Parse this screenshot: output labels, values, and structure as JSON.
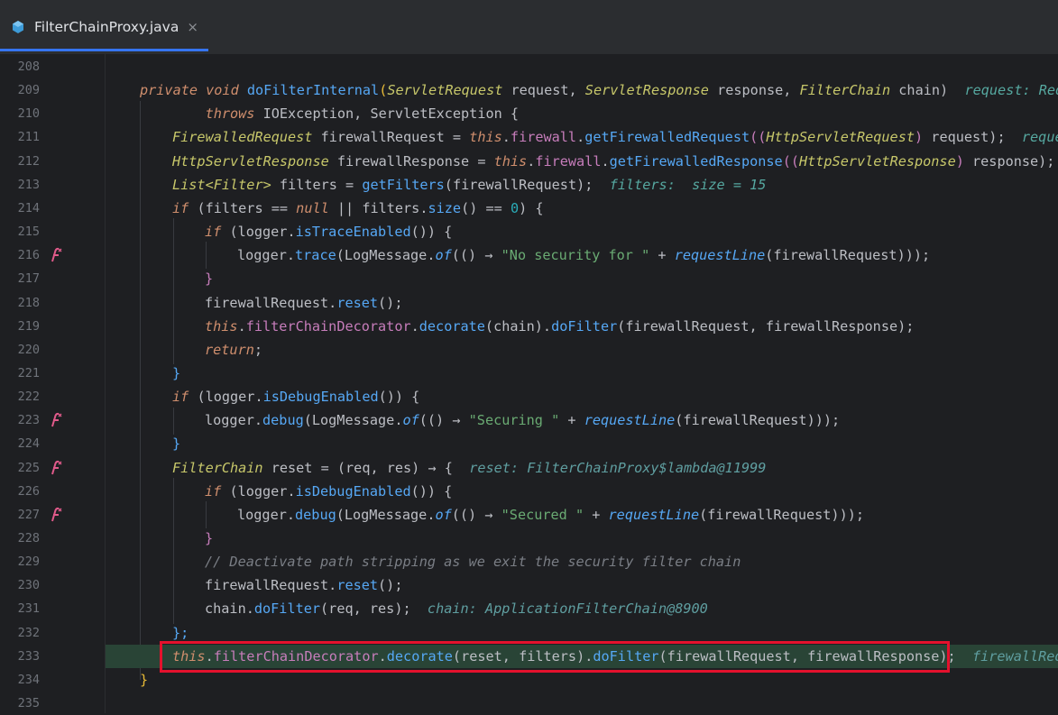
{
  "tabs": [
    {
      "label": "FilterChainProxy.java",
      "active": true,
      "icon": "java-class-icon",
      "close": "×"
    }
  ],
  "editor": {
    "lines": [
      {
        "n": "208"
      },
      {
        "n": "209"
      },
      {
        "n": "210"
      },
      {
        "n": "211"
      },
      {
        "n": "212"
      },
      {
        "n": "213"
      },
      {
        "n": "214"
      },
      {
        "n": "215"
      },
      {
        "n": "216",
        "lambda_icon": true
      },
      {
        "n": "217"
      },
      {
        "n": "218"
      },
      {
        "n": "219"
      },
      {
        "n": "220"
      },
      {
        "n": "221"
      },
      {
        "n": "222"
      },
      {
        "n": "223",
        "lambda_icon": true
      },
      {
        "n": "224"
      },
      {
        "n": "225",
        "lambda_icon": true
      },
      {
        "n": "226"
      },
      {
        "n": "227",
        "lambda_icon": true
      },
      {
        "n": "228"
      },
      {
        "n": "229"
      },
      {
        "n": "230"
      },
      {
        "n": "231"
      },
      {
        "n": "232"
      },
      {
        "n": "233",
        "execution_point": true
      },
      {
        "n": "234"
      },
      {
        "n": "235"
      }
    ],
    "code": {
      "l209": {
        "mods": "private void ",
        "name": "doFilterInternal",
        "p1t": "ServletRequest",
        "p1": " request, ",
        "p2t": "ServletResponse",
        "p2": " response, ",
        "p3t": "FilterChain",
        "p3": " chain)",
        "hint": "request: Requ"
      },
      "l210": {
        "throws": "throws ",
        "rest": "IOException, ServletException {"
      },
      "l211": {
        "t": "FirewalledRequest",
        "v": " firewallRequest = ",
        "this": "this",
        "f": "firewall",
        "m": "getFirewalledRequest",
        "cast": "HttpServletRequest",
        "arg": " request);",
        "hint": "reques"
      },
      "l212": {
        "t": "HttpServletResponse",
        "v": " firewallResponse = ",
        "this": "this",
        "f": "firewall",
        "m": "getFirewalledResponse",
        "cast": "HttpServletResponse",
        "arg": " response);"
      },
      "l213": {
        "t": "List",
        "g": "Filter",
        "v": " filters = ",
        "m": "getFilters",
        "arg": "(firewallRequest);",
        "hint": "filters:  size = 15"
      },
      "l214": {
        "a": "if",
        "b": " (filters ",
        "c": "==",
        "d": " null",
        "e": " || filters.",
        "m": "size",
        "f": "() ",
        "g": "==",
        "h": " 0",
        "i": ") {"
      },
      "l215": {
        "a": "if",
        "b": " (logger.",
        "m": "isTraceEnabled",
        "c": "()) {"
      },
      "l216": {
        "a": "logger.",
        "m": "trace",
        "b": "(LogMessage.",
        "of": "of",
        "c": "(() ",
        "arrow": "→",
        "s": "\"No security for \"",
        "d": " + ",
        "rl": "requestLine",
        "e": "(firewallRequest)));"
      },
      "l217": {
        "a": "}"
      },
      "l218": {
        "a": "firewallRequest.",
        "m": "reset",
        "b": "();"
      },
      "l219": {
        "this": "this",
        "f": "filterChainDecorator",
        "m": "decorate",
        "b": "(chain).",
        "m2": "doFilter",
        "c": "(firewallRequest, firewallResponse);"
      },
      "l220": {
        "a": "return",
        "b": ";"
      },
      "l221": {
        "a": "}"
      },
      "l222": {
        "a": "if",
        "b": " (logger.",
        "m": "isDebugEnabled",
        "c": "()) {"
      },
      "l223": {
        "a": "logger.",
        "m": "debug",
        "b": "(LogMessage.",
        "of": "of",
        "c": "(() ",
        "arrow": "→",
        "s": "\"Securing \"",
        "d": " + ",
        "rl": "requestLine",
        "e": "(firewallRequest)));"
      },
      "l224": {
        "a": "}"
      },
      "l225": {
        "t": "FilterChain",
        "v": " reset = (req, res) ",
        "arrow": "→",
        "b": " {",
        "hint": "reset: FilterChainProxy$lambda@11999"
      },
      "l226": {
        "a": "if",
        "b": " (logger.",
        "m": "isDebugEnabled",
        "c": "()) {"
      },
      "l227": {
        "a": "logger.",
        "m": "debug",
        "b": "(LogMessage.",
        "of": "of",
        "c": "(() ",
        "arrow": "→",
        "s": "\"Secured \"",
        "d": " + ",
        "rl": "requestLine",
        "e": "(firewallRequest)));"
      },
      "l228": {
        "a": "}"
      },
      "l229": {
        "cm": "// Deactivate path stripping as we exit the security filter chain"
      },
      "l230": {
        "a": "firewallRequest.",
        "m": "reset",
        "b": "();"
      },
      "l231": {
        "a": "chain.",
        "m": "doFilter",
        "b": "(req, res);",
        "hint": "chain: ApplicationFilterChain@8900"
      },
      "l232": {
        "a": "};"
      },
      "l233": {
        "this": "this",
        "f": "filterChainDecorator",
        "m": "decorate",
        "b": "(reset, filters).",
        "m2": "doFilter",
        "c": "(firewallRequest, firewallResponse);",
        "hint": "firewallRequ"
      },
      "l234": {
        "a": "}"
      }
    }
  },
  "colors": {
    "accent": "#3574f0",
    "highlight_box": "#e4112d",
    "execution_line": "#294436"
  }
}
